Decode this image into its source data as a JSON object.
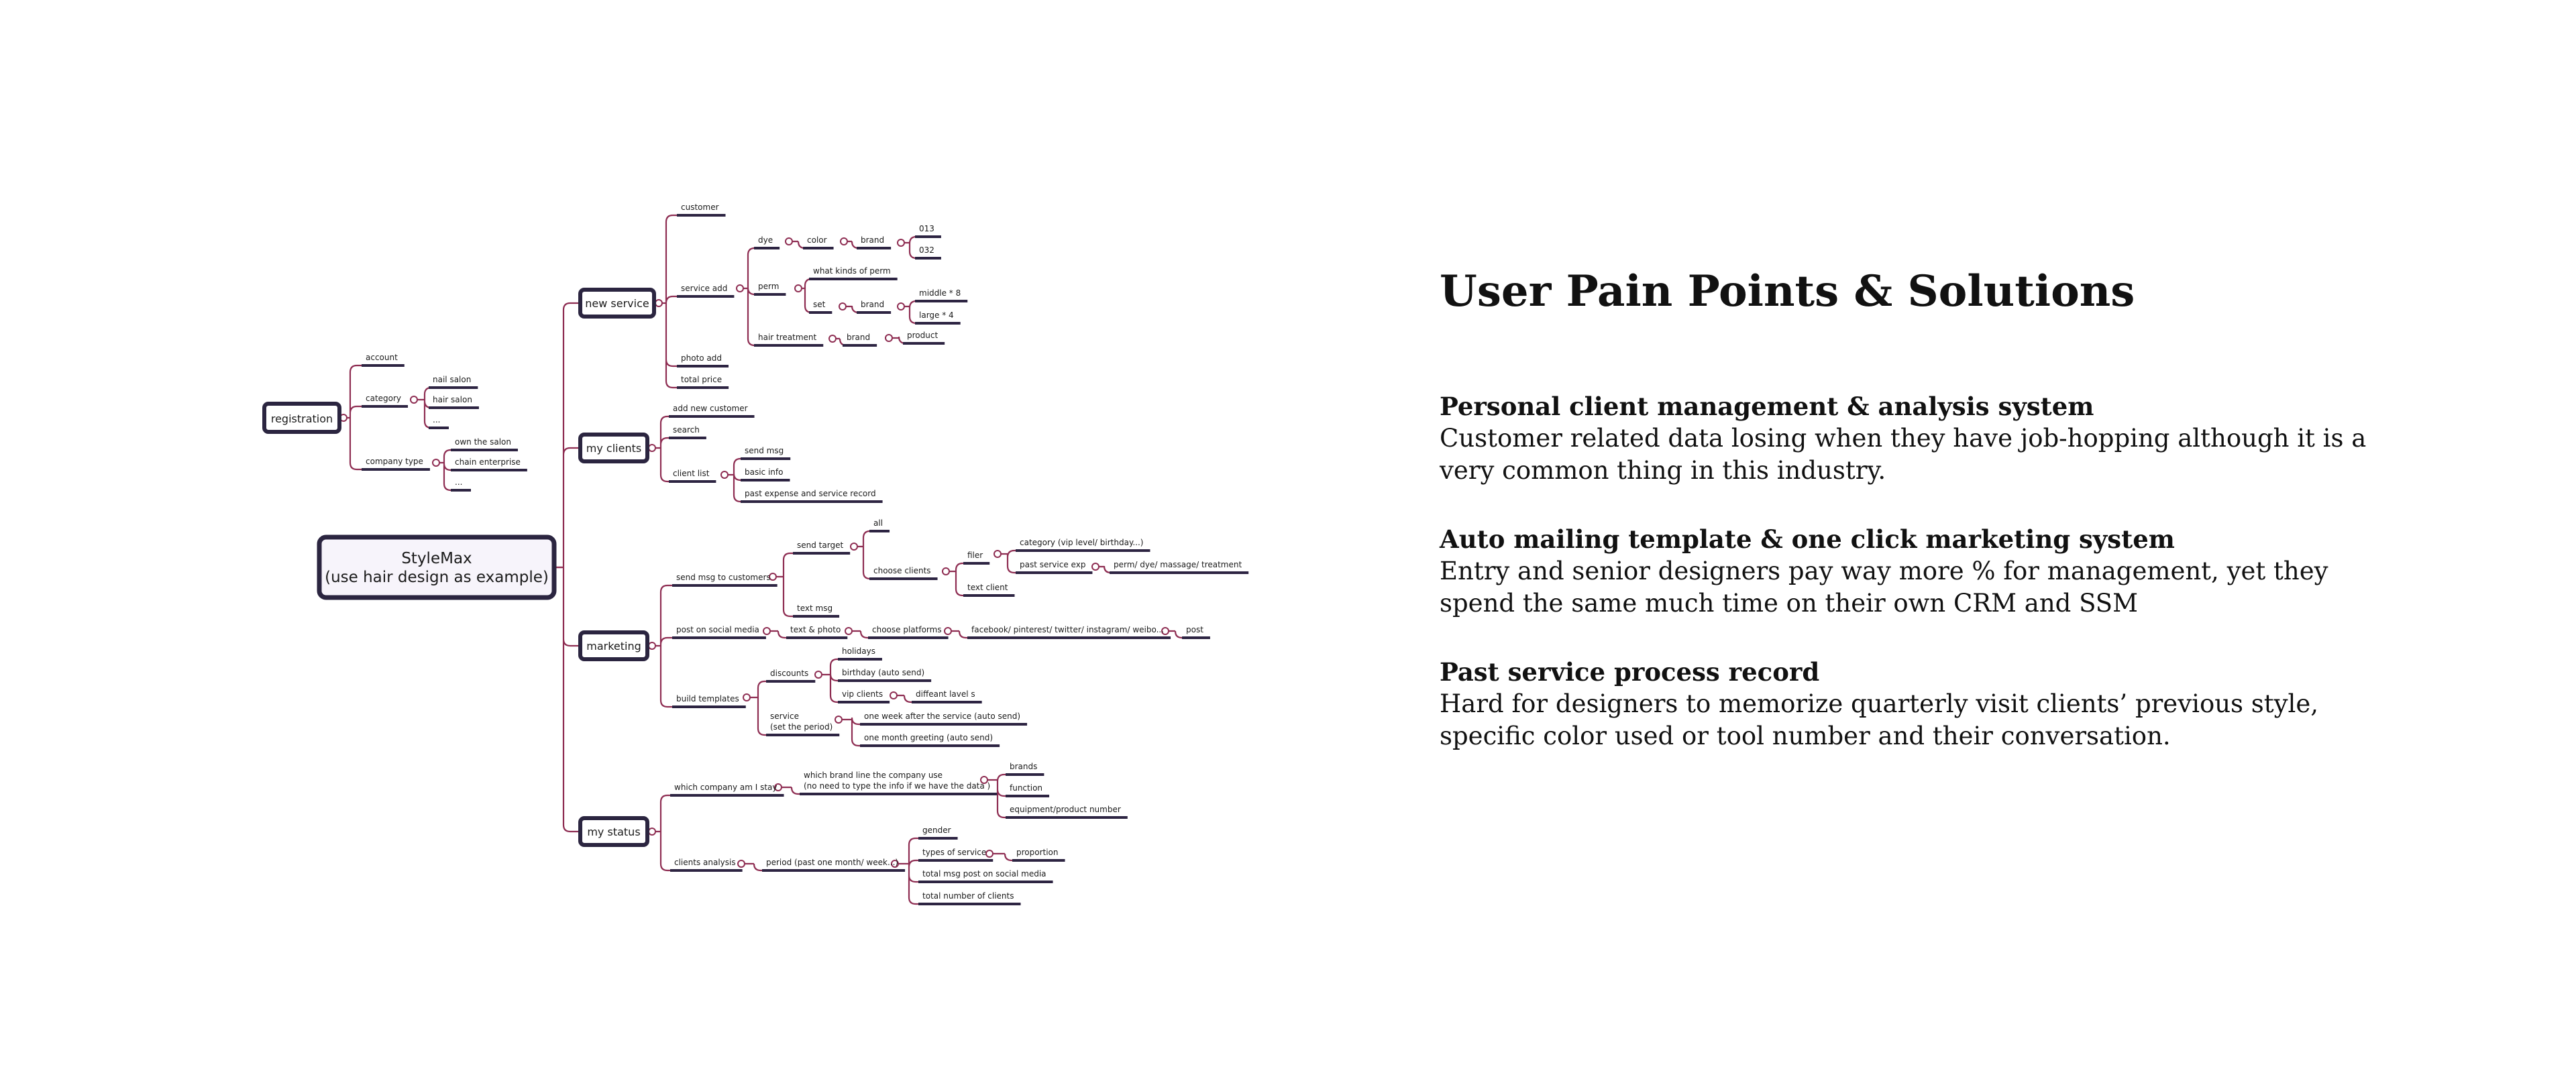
{
  "panel": {
    "title": "User Pain Points & Solutions",
    "points": [
      {
        "heading": "Personal client management & analysis system",
        "body": "Customer related data losing when they have job-hopping although it is a very common thing in this industry."
      },
      {
        "heading": "Auto mailing template & one click marketing system",
        "body": "Entry and senior designers pay way more % for management, yet they spend the same much time on their own CRM and SSM"
      },
      {
        "heading": "Past service process record",
        "body": "Hard for designers to memorize quarterly visit clients’ previous style, specific color used or tool number and their conversation."
      }
    ]
  },
  "mindmap": {
    "root": {
      "line1": "StyleMax",
      "line2": "(use hair design as example)"
    },
    "registration": {
      "label": "registration",
      "account": "account",
      "category": "category",
      "category_items": [
        "nail salon",
        "hair salon",
        "..."
      ],
      "company_type": "company type",
      "company_items": [
        "own the salon",
        "chain enterprise",
        "..."
      ]
    },
    "new_service": {
      "label": "new service",
      "customer": "customer",
      "service_add": "service add",
      "dye": "dye",
      "color": "color",
      "brand": "brand",
      "dye_brand_items": [
        "013",
        "032"
      ],
      "perm": "perm",
      "perm_kinds": "what kinds of perm",
      "set": "set",
      "set_brand": "brand",
      "set_brand_items": [
        "middle * 8",
        "large * 4"
      ],
      "hair_treatment": "hair treatment",
      "ht_brand": "brand",
      "ht_product": "product",
      "photo_add": "photo add",
      "total_price": "total price"
    },
    "my_clients": {
      "label": "my clients",
      "add_new_customer": "add new customer",
      "search": "search",
      "client_list": "client list",
      "client_list_items": [
        "send msg",
        "basic info",
        "past expense and service record"
      ]
    },
    "marketing": {
      "label": "marketing",
      "send_msg": "send msg to customers",
      "send_target": "send target",
      "all": "all",
      "choose_clients": "choose clients",
      "filter": "filer",
      "filter_category": "category (vip level/ birthday...)",
      "past_service_exp": "past service exp",
      "service_types": "perm/ dye/ massage/ treatment",
      "text_client": "text client",
      "text_msg": "text msg",
      "post_social": "post on social media",
      "text_photo": "text & photo",
      "choose_platforms": "choose platforms",
      "platforms": "facebook/ pinterest/ twitter/ instagram/ weibo...",
      "post": "post",
      "build_templates": "build templates",
      "discounts": "discounts",
      "holidays": "holidays",
      "birthday": "birthday (auto send)",
      "vip_clients": "vip clients",
      "diff_level": "diffeant   lavel s",
      "service_period_1": "service",
      "service_period_2": "(set the period)",
      "one_week": "one week after the service (auto send)",
      "one_month": "one month greeting (auto send)"
    },
    "my_status": {
      "label": "my status",
      "which_company": "which company am I stay",
      "brand_line_1": "which brand line the company use",
      "brand_line_2": "(no need to type the info if we have the data )",
      "brands": "brands",
      "function": "function",
      "equipment": "equipment/product number",
      "clients_analysis": "clients analysis",
      "period": "period (past one month/ week...)",
      "gender": "gender",
      "types_of_service": "types of service",
      "proportion": "proportion",
      "total_msg_post": "total msg post on social media",
      "total_clients": "total number of clients"
    }
  },
  "colors": {
    "connector": "#8e2d52",
    "underline": "#2d2442",
    "node_border": "#2b2540",
    "root_fill": "#f7f4fb"
  }
}
